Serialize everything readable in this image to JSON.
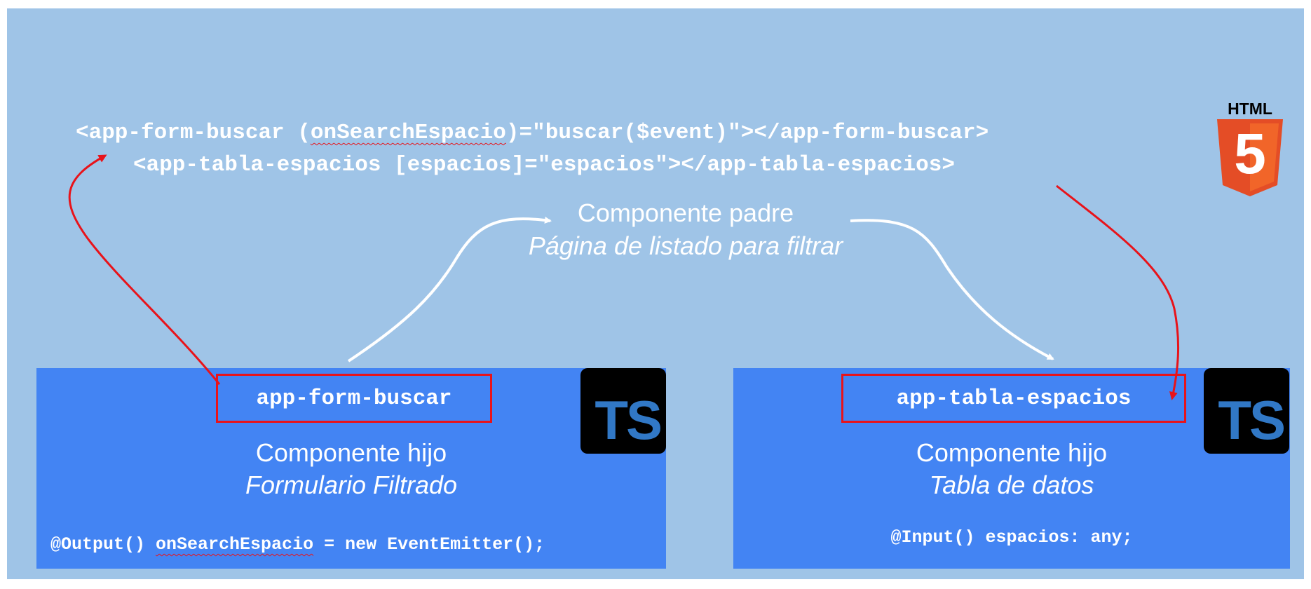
{
  "parent": {
    "line1": {
      "open": "<app-form-buscar (",
      "event": "onSearchEspacio",
      "rest": ")=\"buscar($event)\"></app-form-buscar>"
    },
    "line2": "<app-tabla-espacios [espacios]=\"espacios\"></app-tabla-espacios>",
    "title": "Componente padre",
    "subtitle": "Página de listado para filtrar",
    "html5_badge_label": "HTML",
    "html5_badge_number": "5"
  },
  "children": [
    {
      "selector": "app-form-buscar",
      "title": "Componente hijo",
      "subtitle": "Formulario Filtrado",
      "decl_prefix": "@Output() ",
      "decl_name": "onSearchEspacio",
      "decl_suffix": " = new EventEmitter();",
      "badge": "TS"
    },
    {
      "selector": "app-tabla-espacios",
      "title": "Componente hijo",
      "subtitle": "Tabla de datos",
      "decl": "@Input() espacios: any;",
      "badge": "TS"
    }
  ],
  "colors": {
    "background": "#9fc4e7",
    "child_box": "#4384f3",
    "highlight_red": "#e8131a",
    "ts_blue": "#3178c6",
    "html5_orange": "#e44d26"
  },
  "icons": [
    "html5-logo-icon",
    "typescript-logo-icon"
  ]
}
